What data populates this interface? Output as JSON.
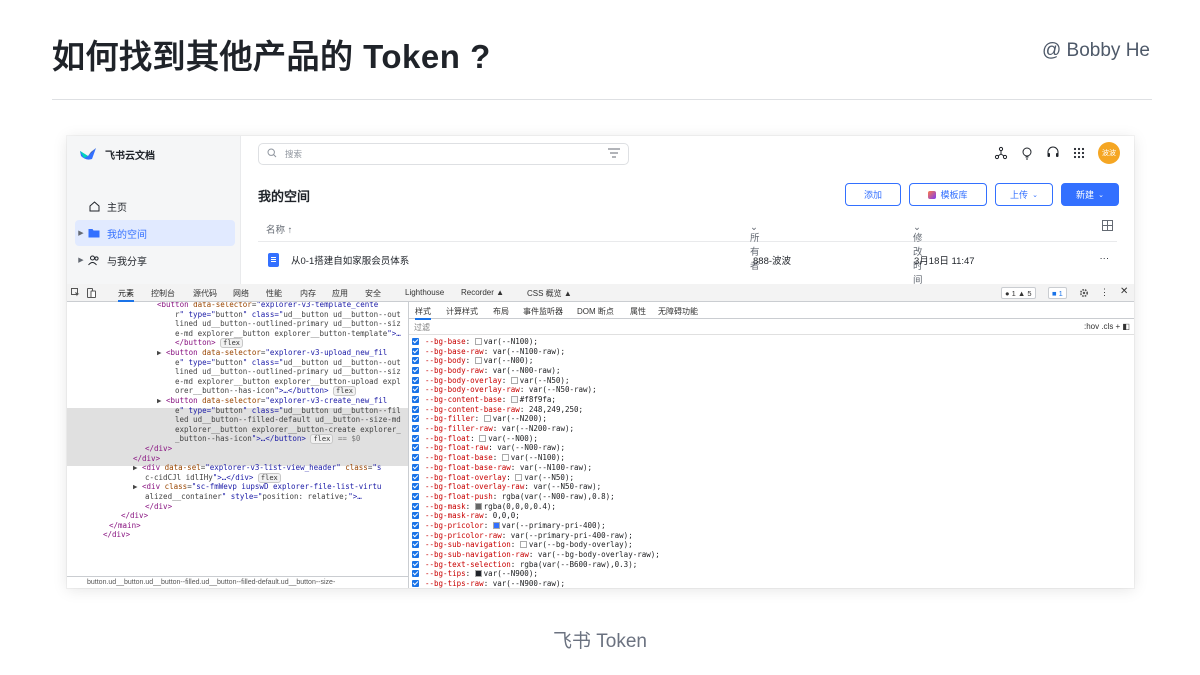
{
  "slide": {
    "title": "如何找到其他产品的 Token ?",
    "author": "@ Bobby He",
    "footer": "飞书 Token"
  },
  "colors": {
    "accent": "#3370ff",
    "sidebar_active_bg": "#e1eaff",
    "avatar": "#f5a623",
    "devtools_tag": "#881280",
    "devtools_attr": "#994500",
    "devtools_value": "#1a1aa6",
    "css_prop": "#c80000"
  },
  "app": {
    "name": "飞书云文档",
    "search_placeholder": "搜索",
    "avatar_text": "波波",
    "sidebar": [
      {
        "label": "主页",
        "icon": "home-icon",
        "has_caret": false
      },
      {
        "label": "我的空间",
        "icon": "folder-icon",
        "has_caret": true,
        "active": true
      },
      {
        "label": "与我分享",
        "icon": "users-icon",
        "has_caret": true
      }
    ],
    "space_title": "我的空间",
    "buttons": {
      "add": "添加",
      "template": "模板库",
      "upload": "上传",
      "new": "新建"
    },
    "columns": {
      "name": "名称 ↑",
      "owner": "所有者",
      "modified": "修改时间"
    },
    "files": [
      {
        "name": "从0-1搭建自如家服会员体系",
        "owner": "888-波波",
        "modified": "3月18日 11:47",
        "more": "···"
      }
    ]
  },
  "devtools": {
    "tabs": [
      "元素",
      "控制台",
      "源代码",
      "网络",
      "性能",
      "内存",
      "应用",
      "安全",
      "Lighthouse",
      "Recorder ▲",
      "CSS 概览 ▲"
    ],
    "selected_tab": "元素",
    "counts": {
      "errors": "● 1",
      "warnings": "▲ 5",
      "messages": "■ 1"
    },
    "elements_lines": [
      {
        "indent": 14,
        "text": "<button data-selector=\"explorer-v3-template_cente"
      },
      {
        "indent": 17,
        "text": "r\" type=\"button\" class=\"ud__button ud__button--out"
      },
      {
        "indent": 17,
        "text": "lined ud__button--outlined-primary ud__button--siz"
      },
      {
        "indent": 17,
        "text": "e-md explorer__button explorer__button-template\">…"
      },
      {
        "indent": 17,
        "text": "</button>",
        "pill": "flex"
      },
      {
        "indent": 14,
        "text": "▶ <button data-selector=\"explorer-v3-upload_new_fil"
      },
      {
        "indent": 17,
        "text": "e\" type=\"button\" class=\"ud__button ud__button--out"
      },
      {
        "indent": 17,
        "text": "lined ud__button--outlined-primary ud__button--siz"
      },
      {
        "indent": 17,
        "text": "e-md explorer__button explorer__button-upload expl"
      },
      {
        "indent": 17,
        "text": "orer__button--has-icon\">…</button>",
        "pill": "flex"
      },
      {
        "indent": 14,
        "text": "▶ <button data-selector=\"explorer-v3-create_new_fil"
      },
      {
        "indent": 17,
        "text": "e\" type=\"button\" class=\"ud__button ud__button--fil"
      },
      {
        "indent": 17,
        "text": "led ud__button--filled-default ud__button--size-md"
      },
      {
        "indent": 17,
        "text": "explorer__button explorer__button-create explorer_"
      },
      {
        "indent": 17,
        "text": "_button--has-icon\">…</button>",
        "pill": "flex",
        "suffix": " == $0"
      },
      {
        "indent": 12,
        "text": "</div>"
      },
      {
        "indent": 10,
        "text": "</div>"
      },
      {
        "indent": 10,
        "text": "▶ <div data-sel=\"explorer-v3-list-view_header\" class=\"s"
      },
      {
        "indent": 12,
        "text": "c-cidCJl idlIHy\">…</div>",
        "pill": "flex"
      },
      {
        "indent": 10,
        "text": "▶ <div class=\"sc-fmWevp iupswD explorer-file-list-virtu"
      },
      {
        "indent": 12,
        "text": "alized__container\" style=\"position: relative;\">…"
      },
      {
        "indent": 12,
        "text": "</div>"
      },
      {
        "indent": 8,
        "text": "</div>"
      },
      {
        "indent": 6,
        "text": "</main>"
      },
      {
        "indent": 5,
        "text": "</div>"
      }
    ],
    "breadcrumb": "button.ud__button.ud__button--filled.ud__button--filled-default.ud__button--size-",
    "style_tabs": [
      "样式",
      "计算样式",
      "布局",
      "事件监听器",
      "DOM 断点",
      "属性",
      "无障碍功能"
    ],
    "filter_label": "过滤",
    "filter_tools": ":hov  .cls  +  ◧",
    "properties": [
      {
        "name": "--bg-base",
        "swatch": "#ffffff",
        "value": "var(--N100);"
      },
      {
        "name": "--bg-base-raw",
        "value": "var(--N100-raw);"
      },
      {
        "name": "--bg-body",
        "swatch": "#ffffff",
        "value": "var(--N00);"
      },
      {
        "name": "--bg-body-raw",
        "value": "var(--N00-raw);"
      },
      {
        "name": "--bg-body-overlay",
        "swatch": "#ffffff",
        "value": "var(--N50);"
      },
      {
        "name": "--bg-body-overlay-raw",
        "value": "var(--N50-raw);"
      },
      {
        "name": "--bg-content-base",
        "swatch": "#f8f9fa",
        "value": "#f8f9fa;"
      },
      {
        "name": "--bg-content-base-raw",
        "value": "248,249,250;"
      },
      {
        "name": "--bg-filler",
        "swatch": "#ffffff",
        "value": "var(--N200);"
      },
      {
        "name": "--bg-filler-raw",
        "value": "var(--N200-raw);"
      },
      {
        "name": "--bg-float",
        "swatch": "#ffffff",
        "value": "var(--N00);"
      },
      {
        "name": "--bg-float-raw",
        "value": "var(--N00-raw);"
      },
      {
        "name": "--bg-float-base",
        "swatch": "#ffffff",
        "value": "var(--N100);"
      },
      {
        "name": "--bg-float-base-raw",
        "value": "var(--N100-raw);"
      },
      {
        "name": "--bg-float-overlay",
        "swatch": "#ffffff",
        "value": "var(--N50);"
      },
      {
        "name": "--bg-float-overlay-raw",
        "value": "var(--N50-raw);"
      },
      {
        "name": "--bg-float-push",
        "value": "rgba(var(--N00-raw),0.8);"
      },
      {
        "name": "--bg-mask",
        "swatch": "#666666",
        "value": "rgba(0,0,0,0.4);"
      },
      {
        "name": "--bg-mask-raw",
        "value": "0,0,0;"
      },
      {
        "name": "--bg-pricolor",
        "swatch": "#3370ff",
        "value": "var(--primary-pri-400);"
      },
      {
        "name": "--bg-pricolor-raw",
        "value": "var(--primary-pri-400-raw);"
      },
      {
        "name": "--bg-sub-navigation",
        "swatch": "#ffffff",
        "value": "var(--bg-body-overlay);"
      },
      {
        "name": "--bg-sub-navigation-raw",
        "value": "var(--bg-body-overlay-raw);"
      },
      {
        "name": "--bg-text-selection",
        "value": "rgba(var(--B600-raw),0.3);"
      },
      {
        "name": "--bg-tips",
        "swatch": "#1f2329",
        "value": "var(--N900);"
      },
      {
        "name": "--bg-tips-raw",
        "value": "var(--N900-raw);"
      }
    ]
  }
}
